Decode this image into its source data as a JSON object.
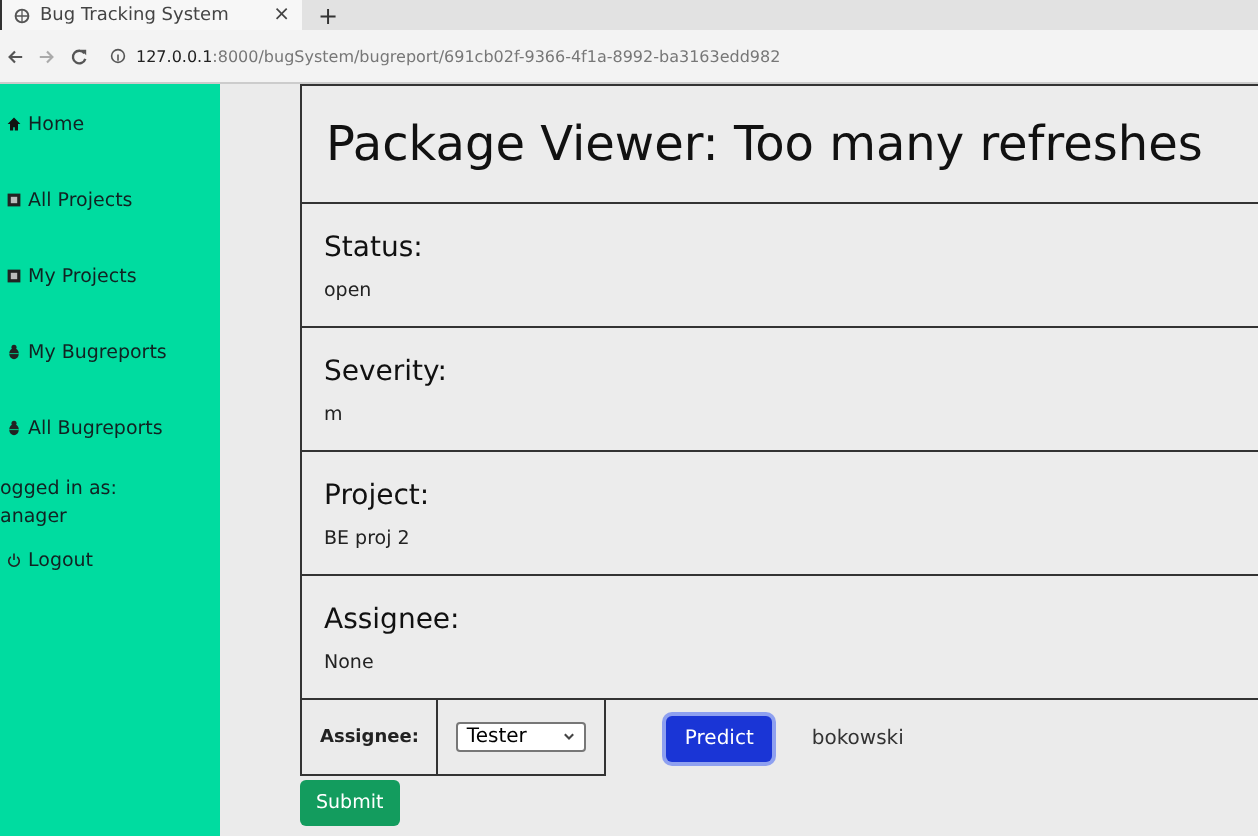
{
  "browser": {
    "tab_title": "Bug Tracking System",
    "tab_close": "×",
    "new_tab": "+",
    "url_host": "127.0.0.1",
    "url_rest": ":8000/bugSystem/bugreport/691cb02f-9366-4f1a-8992-ba3163edd982"
  },
  "sidebar": {
    "items": [
      {
        "label": "Home",
        "kind": "home"
      },
      {
        "label": "All Projects",
        "kind": "project"
      },
      {
        "label": "My Projects",
        "kind": "project"
      },
      {
        "label": "My Bugreports",
        "kind": "bug"
      },
      {
        "label": "All Bugreports",
        "kind": "bug"
      }
    ],
    "logged_in_label": "ogged in as:",
    "user": "anager",
    "logout": "Logout"
  },
  "title": "Package Viewer: Too many refreshes",
  "fields": [
    {
      "label": "Status:",
      "value": "open"
    },
    {
      "label": "Severity:",
      "value": "m"
    },
    {
      "label": "Project:",
      "value": "BE proj 2"
    },
    {
      "label": "Assignee:",
      "value": "None"
    }
  ],
  "form": {
    "label": "Assignee:",
    "select_value": "Tester",
    "predict": "Predict",
    "prediction": "bokowski",
    "submit": "Submit"
  }
}
